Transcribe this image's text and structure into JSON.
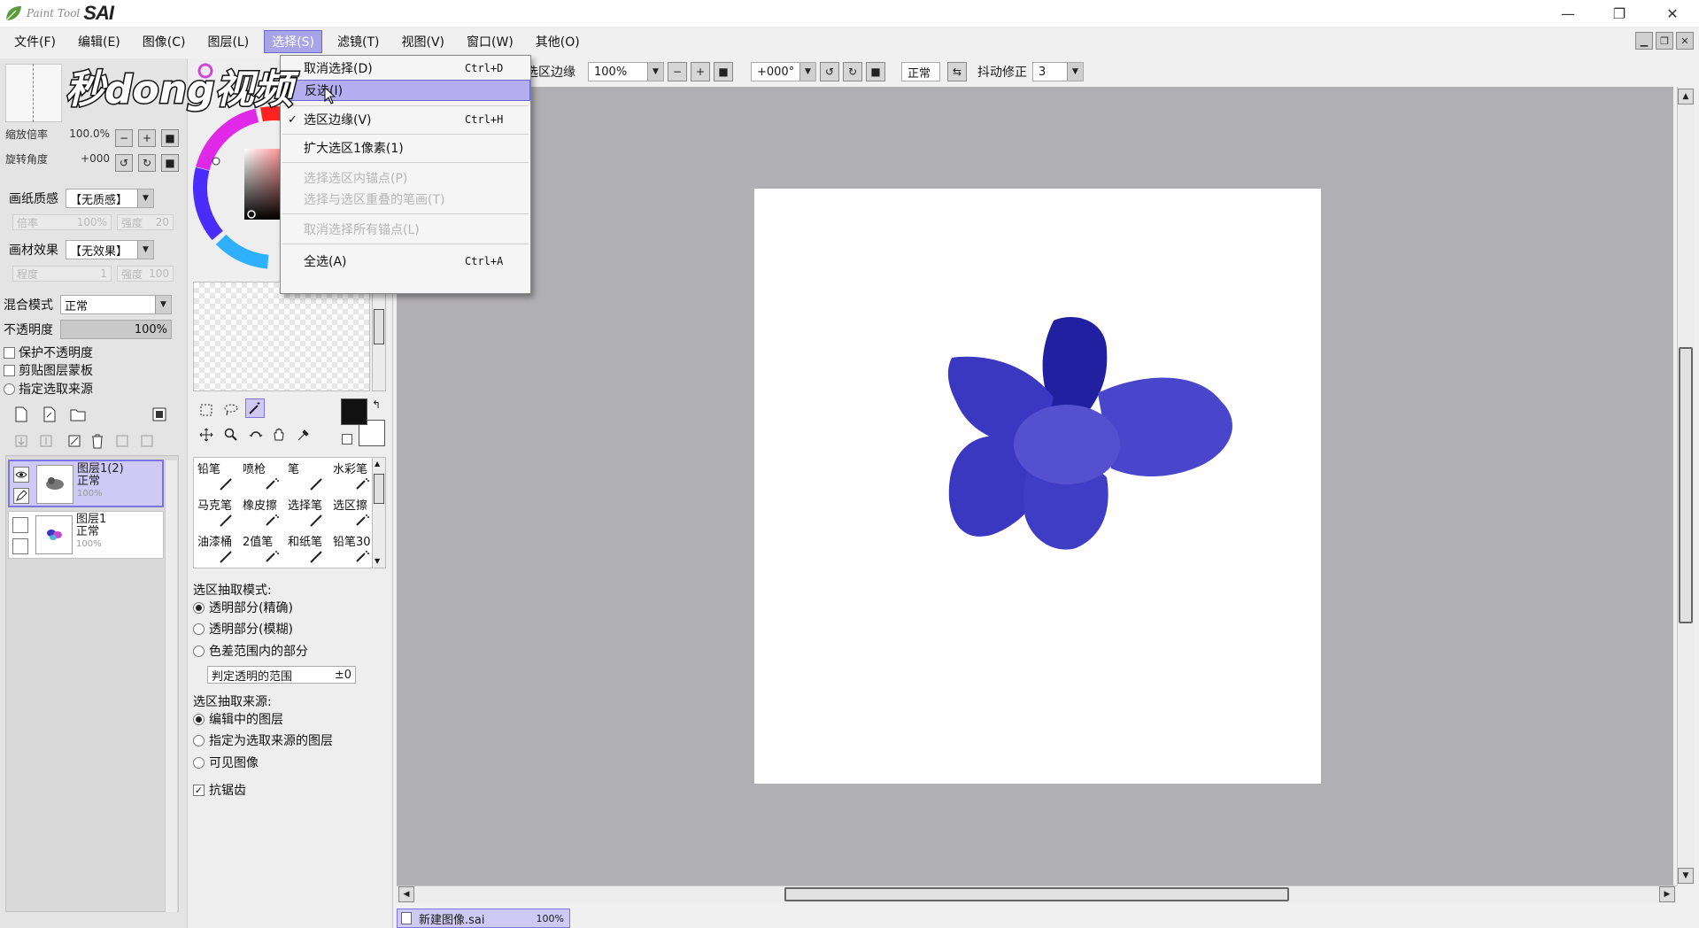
{
  "app": {
    "logo_small": "Paint Tool",
    "logo_big": "SAI",
    "window_controls": [
      "—",
      "❐",
      "✕"
    ]
  },
  "menubar": [
    {
      "label": "文件(F)"
    },
    {
      "label": "编辑(E)"
    },
    {
      "label": "图像(C)"
    },
    {
      "label": "图层(L)"
    },
    {
      "label": "选择(S)",
      "active": true
    },
    {
      "label": "滤镜(T)"
    },
    {
      "label": "视图(V)"
    },
    {
      "label": "窗口(W)"
    },
    {
      "label": "其他(O)"
    }
  ],
  "selection_menu": {
    "items": [
      {
        "label": "取消选择(D)",
        "shortcut": "Ctrl+D",
        "state": "normal"
      },
      {
        "label": "反选(I)",
        "shortcut": "",
        "state": "highlight"
      },
      {
        "label": "选区边缘(V)",
        "shortcut": "Ctrl+H",
        "state": "checked"
      },
      {
        "label": "扩大选区1像素(1)",
        "shortcut": "",
        "state": "normal"
      },
      {
        "label": "选择选区内锚点(P)",
        "shortcut": "",
        "state": "disabled"
      },
      {
        "label": "选择与选区重叠的笔画(T)",
        "shortcut": "",
        "state": "disabled"
      },
      {
        "label": "取消选择所有锚点(L)",
        "shortcut": "",
        "state": "disabled"
      },
      {
        "label": "全选(A)",
        "shortcut": "Ctrl+A",
        "state": "normal"
      }
    ]
  },
  "toolbar": {
    "select_edge_label": "选区边缘",
    "zoom": "100%",
    "rotation": "+000°",
    "blend": "正常",
    "stabilizer_label": "抖动修正",
    "stabilizer_value": "3"
  },
  "navigator": {
    "zoom_label": "缩放倍率",
    "zoom_value": "100.0%",
    "angle_label": "旋转角度",
    "angle_value": "+000"
  },
  "layer_props": {
    "paper_texture_label": "画纸质感",
    "paper_texture_value": "【无质感】",
    "scale_label": "倍率",
    "scale_value": "100%",
    "strength_label": "强度",
    "strength_value": "20",
    "material_label": "画材效果",
    "material_value": "【无效果】",
    "degree_label": "程度",
    "degree_value": "1",
    "strength2_value": "100",
    "blend_label": "混合模式",
    "blend_value": "正常",
    "opacity_label": "不透明度",
    "opacity_value": "100%",
    "opacity_fraction": 1.0,
    "protect_opacity": "保护不透明度",
    "clip_mask": "剪贴图层蒙板",
    "select_source": "指定选取来源"
  },
  "layers": [
    {
      "name": "图层1(2)",
      "mode": "正常",
      "opacity": "100%",
      "selected": true,
      "visible": true
    },
    {
      "name": "图层1",
      "mode": "正常",
      "opacity": "100%",
      "selected": false,
      "visible": false
    }
  ],
  "brushes": [
    {
      "label": "铅笔"
    },
    {
      "label": "喷枪"
    },
    {
      "label": "笔"
    },
    {
      "label": "水彩笔"
    },
    {
      "label": "马克笔"
    },
    {
      "label": "橡皮擦"
    },
    {
      "label": "选择笔"
    },
    {
      "label": "选区擦"
    },
    {
      "label": "油漆桶"
    },
    {
      "label": "2值笔"
    },
    {
      "label": "和纸笔"
    },
    {
      "label": "铅笔30"
    }
  ],
  "magic_wand": {
    "mode_label": "选区抽取模式:",
    "modes": [
      "透明部分(精确)",
      "透明部分(模糊)",
      "色差范围内的部分"
    ],
    "mode_selected": 0,
    "range_label": "判定透明的范围",
    "range_value": "±0",
    "source_label": "选区抽取来源:",
    "sources": [
      "编辑中的图层",
      "指定为选取来源的图层",
      "可见图像"
    ],
    "source_selected": 0,
    "antialias_label": "抗锯齿",
    "antialias": true
  },
  "document_tab": {
    "name": "新建图像.sai",
    "zoom": "100%"
  },
  "watermark": {
    "text": "秒dong视频"
  },
  "colors": {
    "accent": "#a9a4e8",
    "petal_dark": "#2120a0",
    "petal_mid": "#3a37c0",
    "petal_light": "#4a46cc",
    "center": "#5450cf",
    "canvas_bg": "#b0afb3"
  }
}
